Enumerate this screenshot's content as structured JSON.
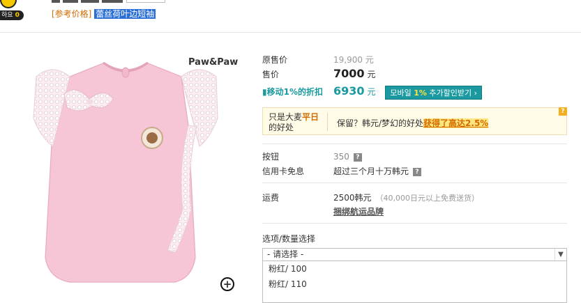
{
  "top": {
    "badge_text": "하요",
    "badge_count": "0",
    "ref_price_label": "[参考价格]",
    "ref_price_value": "蕾丝荷叶边短袖"
  },
  "product": {
    "brand_logo": "Paw&Paw"
  },
  "price": {
    "original_label": "原售价",
    "original_value": "19,900 元",
    "sale_label": "售价",
    "sale_value": "7000",
    "sale_unit": "元",
    "mobile_label": "移动1%的折扣",
    "mobile_value": "6930",
    "mobile_unit": "元",
    "mobile_button_pre": "모바일 ",
    "mobile_button_hl": "1%",
    "mobile_button_post": " 추가할인받기 ›"
  },
  "promo": {
    "left_line1_pre": "只是大麦",
    "left_line1_hl": "平日",
    "left_line2": "的好处",
    "right_text": "保留？韩元/梦幻的好处",
    "right_link": "获得了高达2.5%",
    "help": "?"
  },
  "points": {
    "label": "按钮",
    "value": "350",
    "help": "?"
  },
  "interest": {
    "label": "信用卡免息",
    "value": "超过三个月十万韩元",
    "help": "?"
  },
  "shipping": {
    "label": "运费",
    "value": "2500韩元",
    "note": "（40,000日元以上免费送货）",
    "link": "捆绑航运品牌"
  },
  "options": {
    "label": "选项/数量选择",
    "select_value": "- 请选择 -",
    "items": [
      "粉红/ 100",
      "粉红/ 110"
    ]
  },
  "colors": {
    "accent_orange": "#d36b00",
    "teal": "#1a9aa0",
    "shirt_pink": "#f7c6d6"
  }
}
